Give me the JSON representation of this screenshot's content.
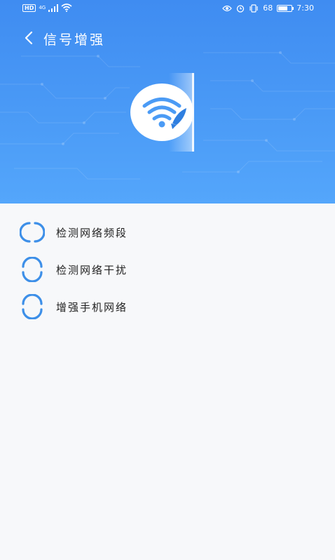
{
  "status_bar": {
    "hd": "HD",
    "network": "4G",
    "battery_percent": "68",
    "battery_level": 0.68,
    "time": "7:30",
    "icons": [
      "hd-icon",
      "signal-icon",
      "wifi-icon",
      "eye-icon",
      "alarm-icon",
      "vibrate-icon",
      "battery-icon"
    ]
  },
  "header": {
    "title": "信号增强",
    "back_icon": "chevron-left-icon",
    "emblem_icon": "wifi-rocket-icon"
  },
  "tasks": [
    {
      "label": "检测网络频段",
      "icon": "loading-spinner-icon",
      "state": "loading"
    },
    {
      "label": "检测网络干扰",
      "icon": "pending-spinner-icon",
      "state": "pending"
    },
    {
      "label": "增强手机网络",
      "icon": "pending-spinner-icon",
      "state": "pending"
    }
  ],
  "colors": {
    "hero_top": "#3f8cf1",
    "hero_bottom": "#54a6fb",
    "accent": "#3d8fe8",
    "background": "#f7f8fa",
    "text": "#222222"
  }
}
